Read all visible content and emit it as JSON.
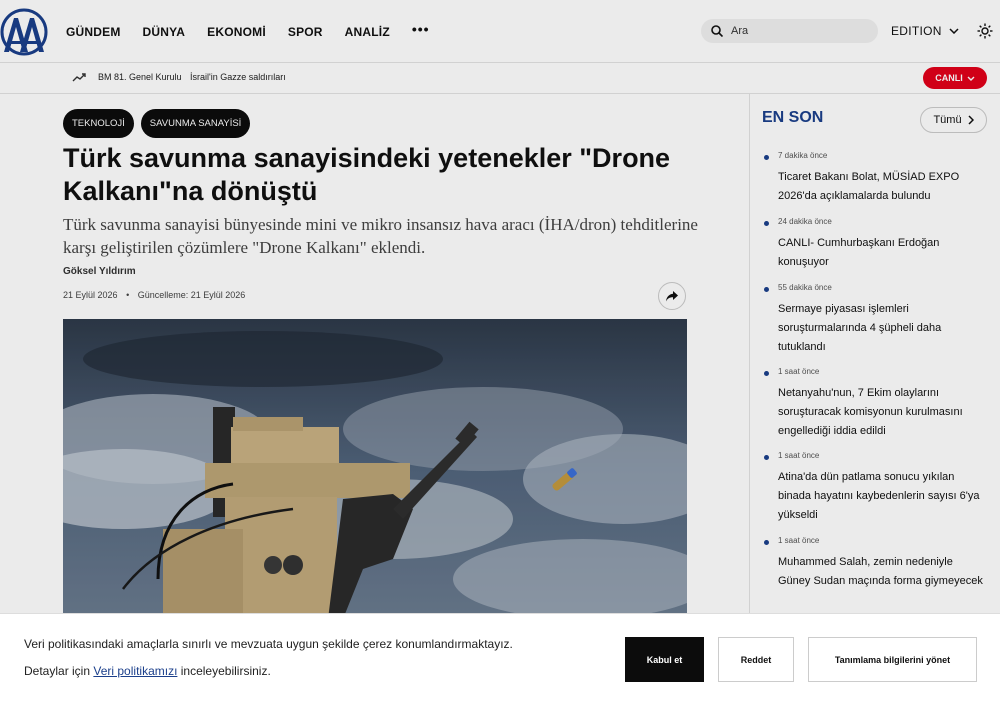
{
  "header": {
    "nav": [
      "GÜNDEM",
      "DÜNYA",
      "EKONOMİ",
      "SPOR",
      "ANALİZ"
    ],
    "more_label": "•••",
    "search_placeholder": "Ara",
    "edition_label": "EDITION"
  },
  "subbar": {
    "trends": [
      "BM 81. Genel Kurulu",
      "İsrail'in Gazze saldırıları"
    ],
    "live_label": "CANLI"
  },
  "article": {
    "tags": [
      "TEKNOLOJİ",
      "SAVUNMA SANAYİSİ"
    ],
    "title": "Türk savunma sanayisindeki yetenekler \"Drone Kalkanı\"na dönüştü",
    "summary": "Türk savunma sanayisi bünyesinde mini ve mikro insansız hava aracı (İHA/dron) tehditlerine karşı geliştirilen çözümlere \"Drone Kalkanı\" eklendi.",
    "author": "Göksel Yıldırım",
    "date": "21 Eylül 2026",
    "updated": "Güncelleme: 21 Eylül 2026",
    "date_separator": "•"
  },
  "sidebar": {
    "header": "EN SON",
    "all_label": "Tümü",
    "items": [
      {
        "time": "7 dakika önce",
        "headline": "Ticaret Bakanı Bolat, MÜSİAD EXPO 2026'da açıklamalarda bulundu"
      },
      {
        "time": "24 dakika önce",
        "headline": "CANLI- Cumhurbaşkanı Erdoğan konuşuyor"
      },
      {
        "time": "55 dakika önce",
        "headline": "Sermaye piyasası işlemleri soruşturmalarında 4 şüpheli daha tutuklandı"
      },
      {
        "time": "1 saat önce",
        "headline": "Netanyahu'nun, 7 Ekim olaylarını soruşturacak komisyonun kurulmasını engellediği iddia edildi"
      },
      {
        "time": "1 saat önce",
        "headline": "Atina'da dün patlama sonucu yıkılan binada hayatını kaybedenlerin sayısı 6'ya yükseldi"
      },
      {
        "time": "1 saat önce",
        "headline": "Muhammed Salah, zemin nedeniyle Güney Sudan maçında forma giymeyecek"
      }
    ]
  },
  "cookie": {
    "line1": "Veri politikasındaki amaçlarla sınırlı ve mevzuata uygun şekilde çerez konumlandırmaktayız.",
    "line2_prefix": "Detaylar için",
    "line2_link": "Veri politikamızı",
    "line2_suffix": "inceleyebilirsiniz.",
    "accept": "Kabul et",
    "reject": "Reddet",
    "manage": "Tanımlama bilgilerini yönet"
  },
  "colors": {
    "brand_blue": "#1b3f8b",
    "live_red": "#e2001a"
  }
}
